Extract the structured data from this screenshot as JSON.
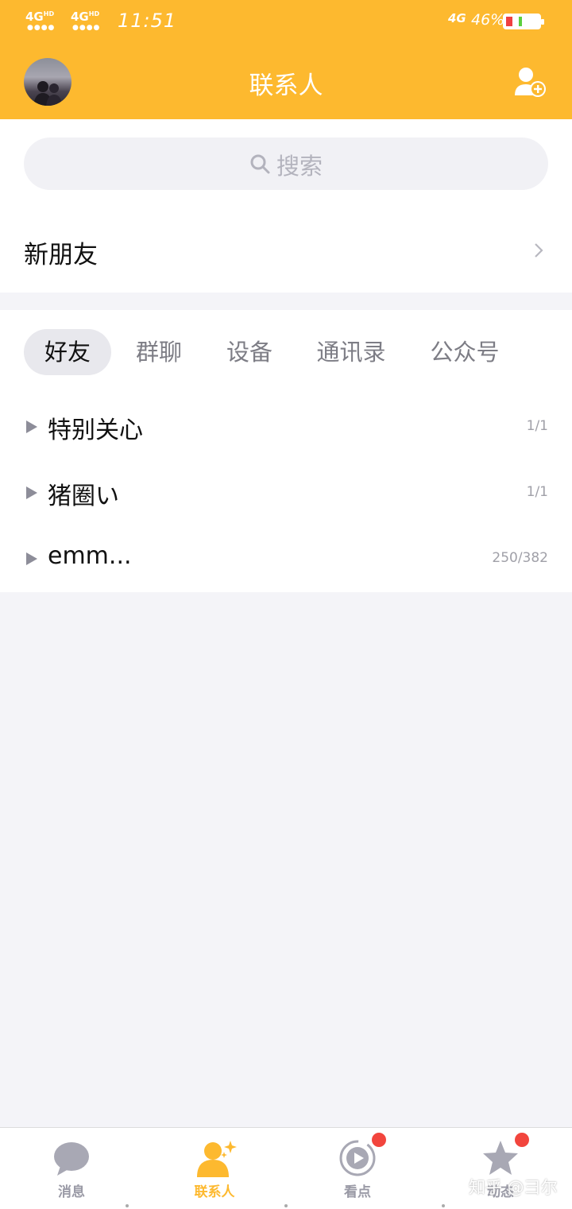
{
  "status_bar": {
    "sig1": "4G",
    "sig1_hd": "HD",
    "sig2": "4G",
    "sig2_hd": "HD",
    "sig_dots": "●●●●",
    "time": "11:51",
    "net": "4G",
    "battery_pct": "46%",
    "battery_level": 0.46
  },
  "header": {
    "title": "联系人",
    "add_contact_icon": "add-contact-icon"
  },
  "search": {
    "placeholder": "搜索"
  },
  "new_friends": {
    "label": "新朋友"
  },
  "tabs": [
    {
      "label": "好友",
      "active": true
    },
    {
      "label": "群聊",
      "active": false
    },
    {
      "label": "设备",
      "active": false
    },
    {
      "label": "通讯录",
      "active": false
    },
    {
      "label": "公众号",
      "active": false
    }
  ],
  "groups": [
    {
      "name": "特别关心",
      "count": "1/1"
    },
    {
      "name": "猪圈い",
      "count": "1/1"
    },
    {
      "name": "emm...",
      "count": "250/382"
    }
  ],
  "bottom_nav": [
    {
      "label": "消息",
      "icon": "chat-bubble-icon",
      "active": false,
      "badge": false
    },
    {
      "label": "联系人",
      "icon": "contacts-icon",
      "active": true,
      "badge": false
    },
    {
      "label": "看点",
      "icon": "play-icon",
      "active": false,
      "badge": true
    },
    {
      "label": "动态",
      "icon": "star-icon",
      "active": false,
      "badge": true
    }
  ],
  "watermark": "知乎 @彐尔",
  "colors": {
    "accent": "#fdb92f",
    "badge": "#f2453d"
  }
}
